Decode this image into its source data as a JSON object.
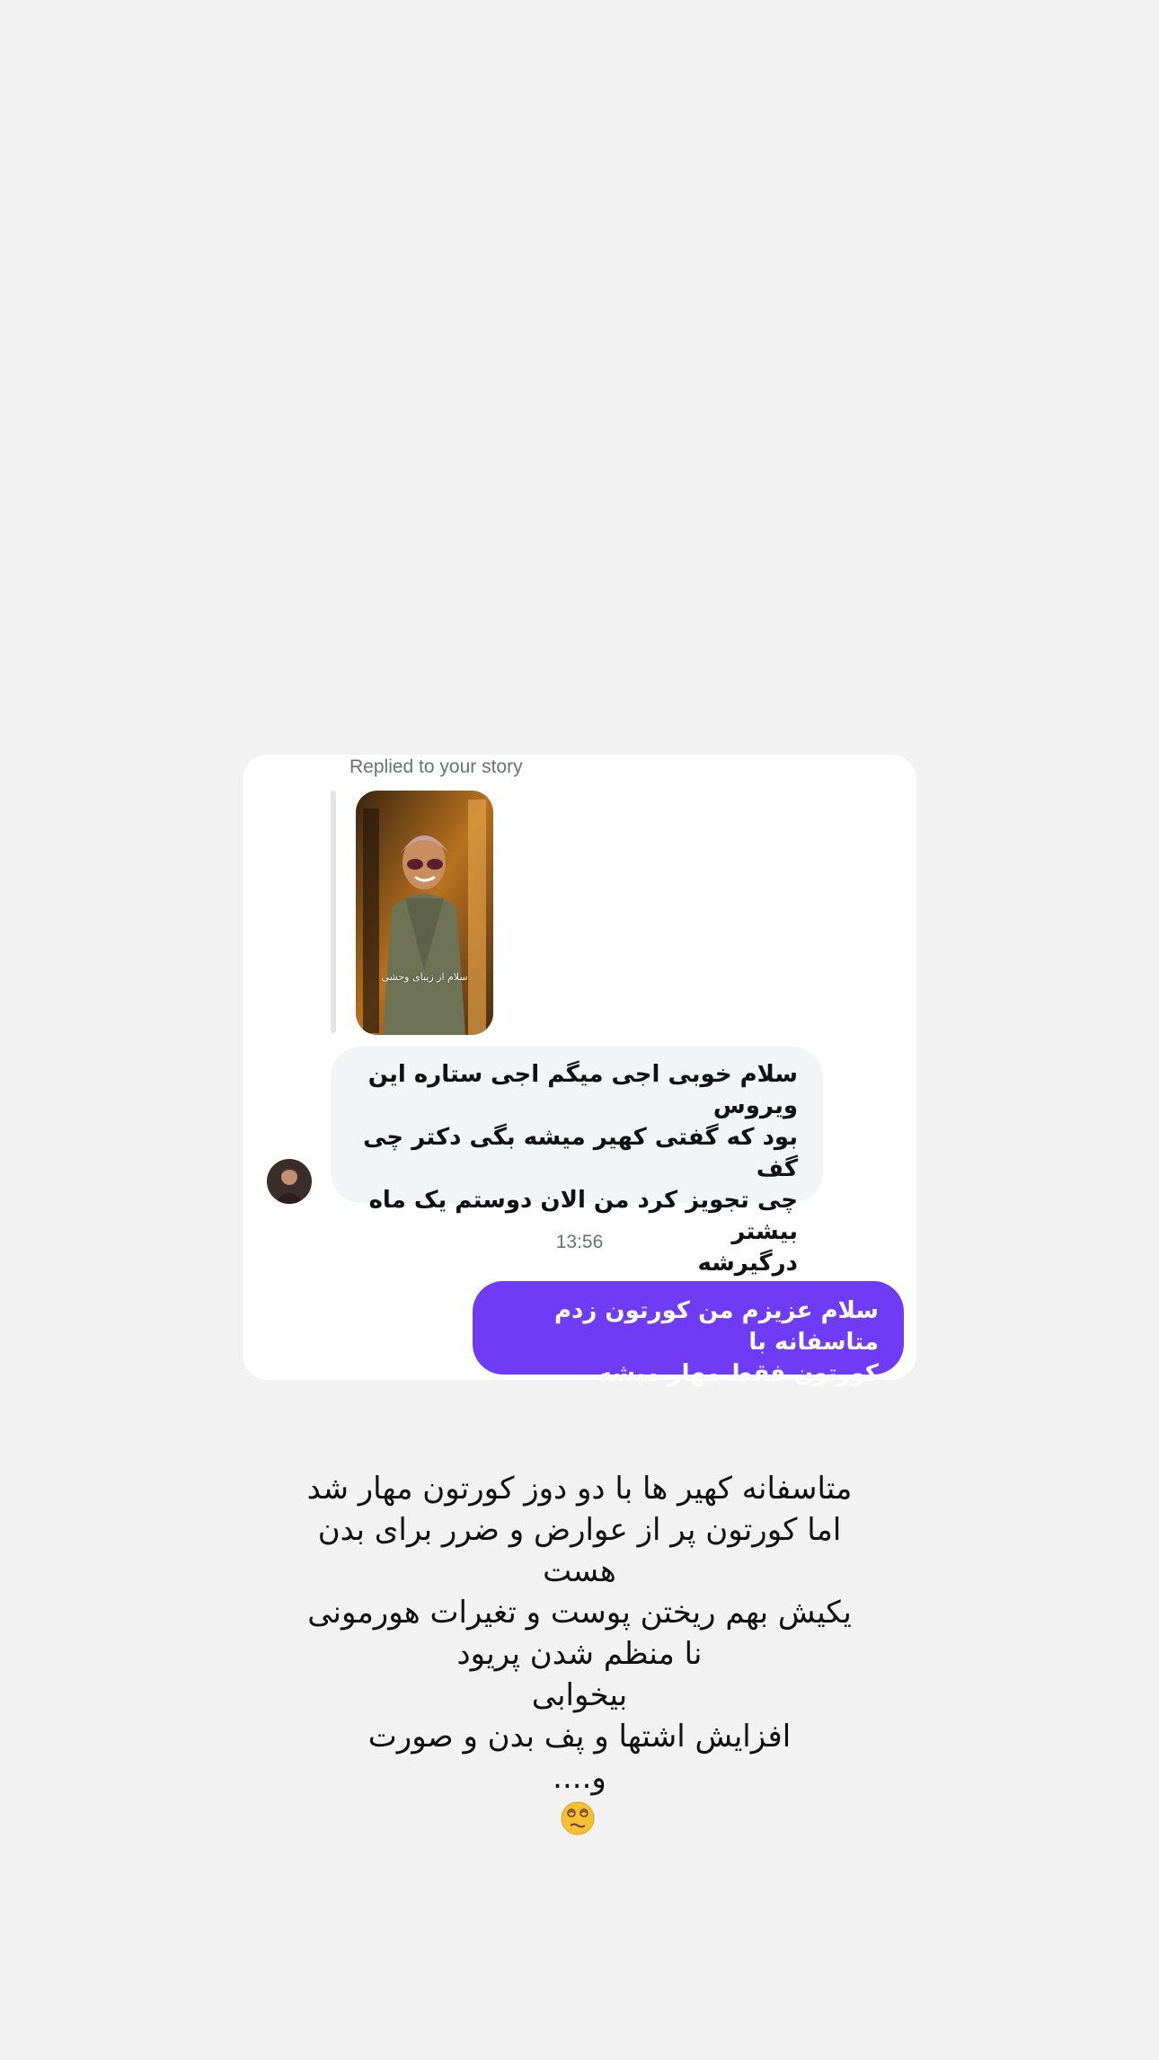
{
  "chat": {
    "reply_label": "Replied to your story",
    "story_caption": "سلام از زیبای وحشی",
    "incoming_message": {
      "lines": [
        "سلام خوبی اجی میگم اجی ستاره این ویروس",
        "بود که گفتی کهیر میشه بگی دکتر چی گف",
        "چی تجویز کرد من الان دوستم یک ماه بیشتر",
        "درگیرشه"
      ]
    },
    "timestamp": "13:56",
    "outgoing_message": {
      "lines": [
        "سلام عزیزم من کورتون زدم متاسفانه با",
        "کورتون فقط مهار میشه"
      ]
    },
    "colors": {
      "outgoing_bubble": "#6f3bf5",
      "incoming_bubble": "#f3f4f6",
      "background": "#f2f2f2"
    }
  },
  "story_text": {
    "lines": [
      "متاسفانه کهیر ها با دو دوز کورتون مهار شد",
      "اما کورتون پر از عوارض و ضرر برای بدن",
      "هست",
      "یکیش بهم ریختن پوست  و تغیرات هورمونی",
      "نا منظم شدن پریود",
      "بیخوابی",
      "افزایش اشتها و پف بدن و صورت",
      "و...."
    ],
    "emoji": "dizzy-face-emoji"
  }
}
